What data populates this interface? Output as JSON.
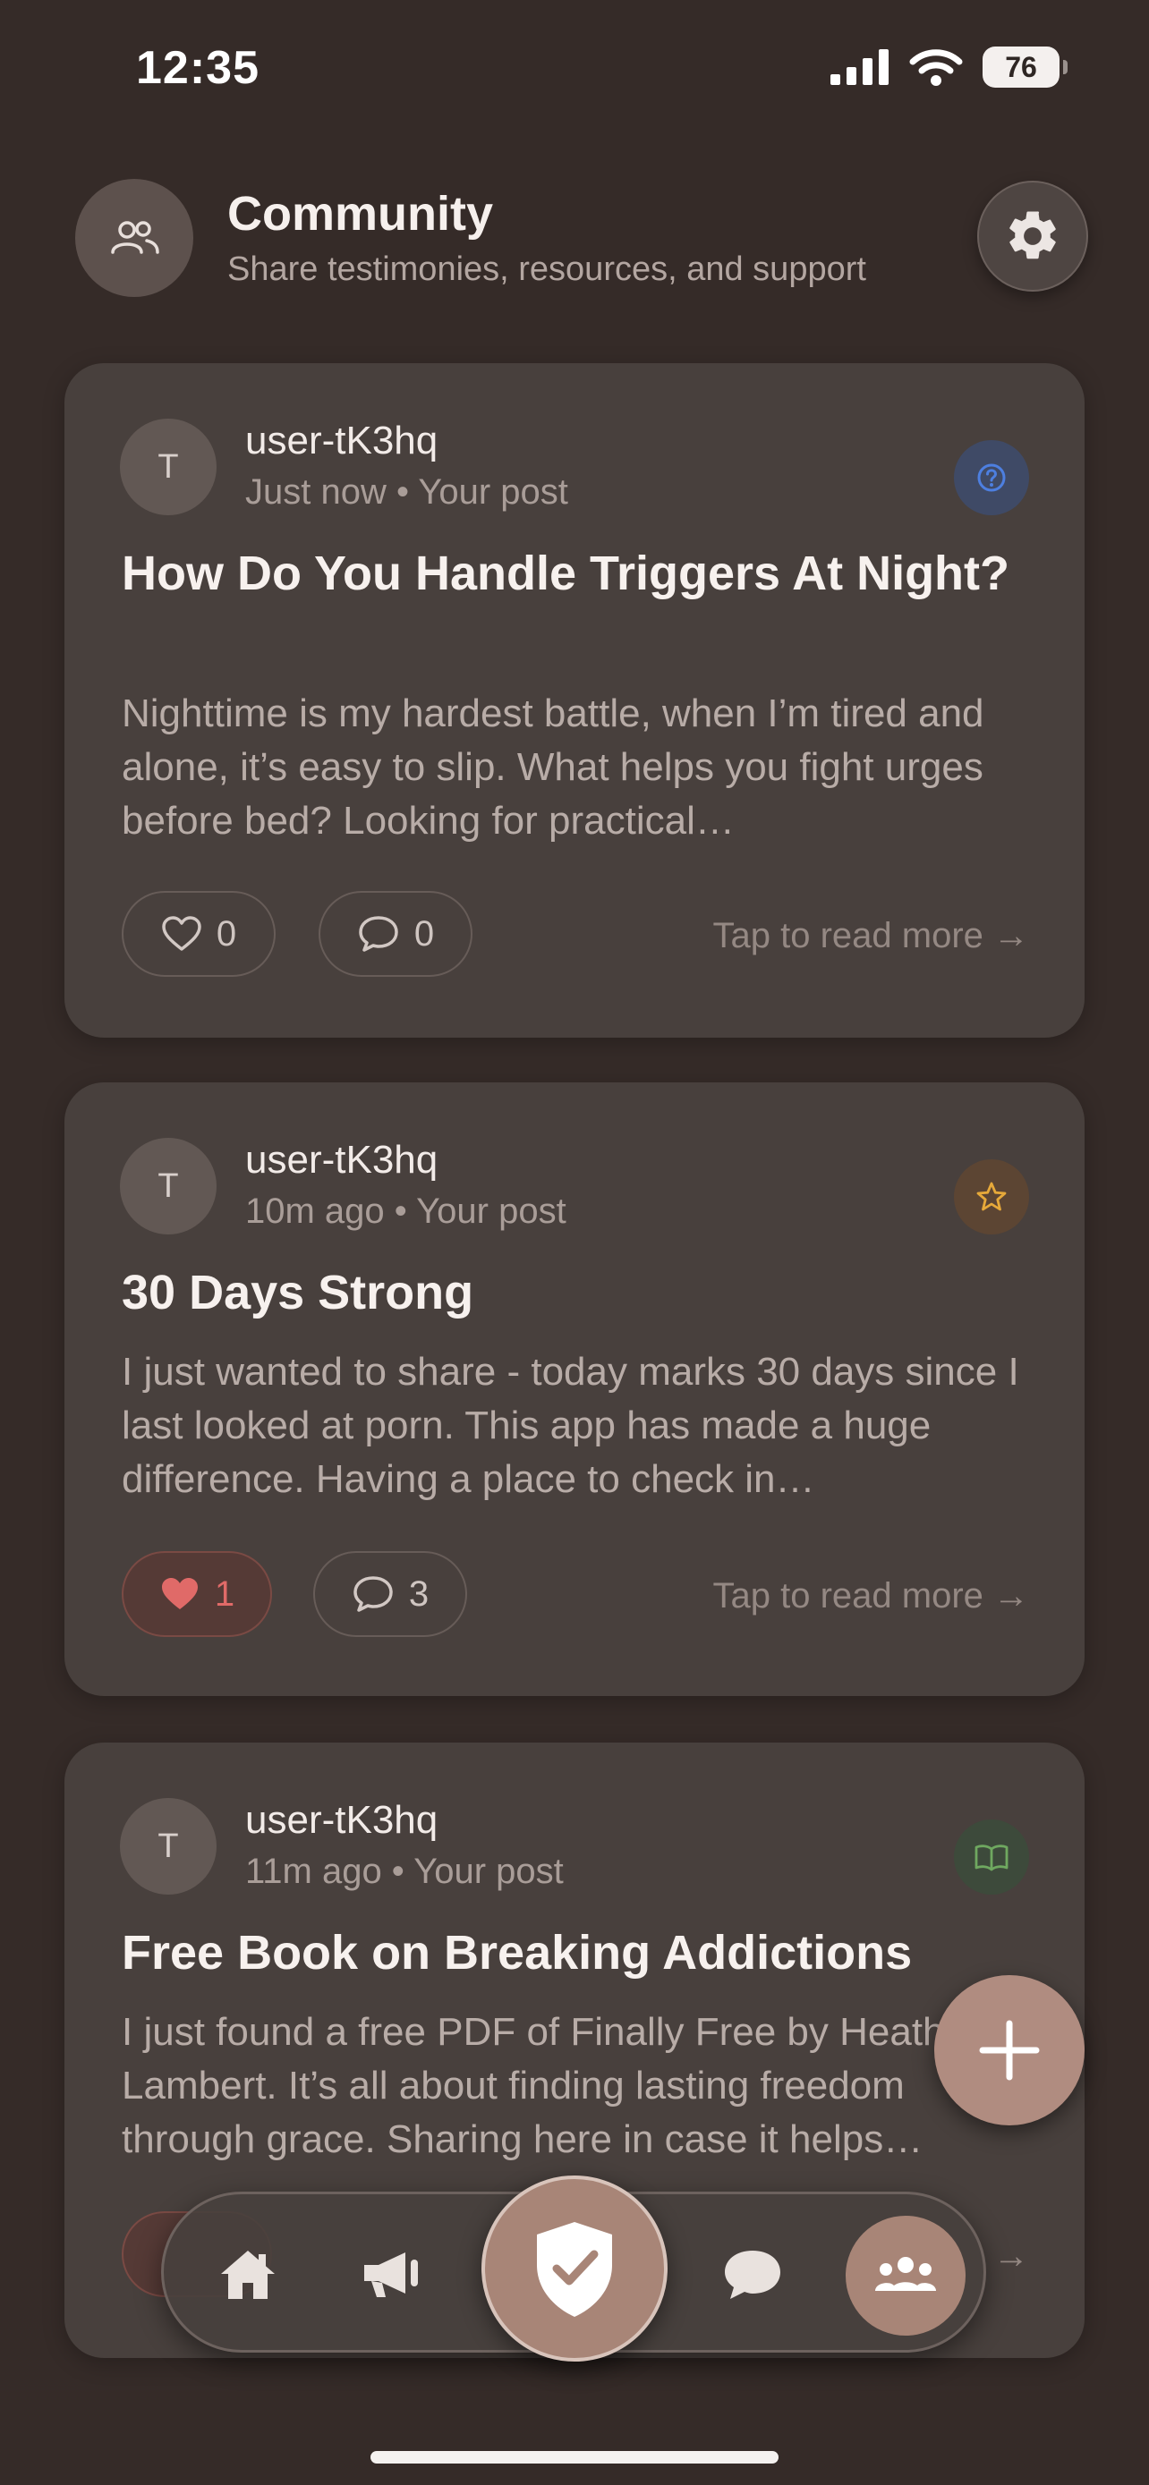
{
  "status_bar": {
    "time": "12:35",
    "battery": "76"
  },
  "header": {
    "title": "Community",
    "subtitle": "Share testimonies, resources, and support",
    "icon": "people-icon",
    "settings_icon": "gear-icon"
  },
  "posts": [
    {
      "avatar_initial": "T",
      "author": "user-tK3hq",
      "meta": "Just now • Your post",
      "type_icon": "question-icon",
      "title": "How Do You Handle Triggers At Night?",
      "excerpt": "Nighttime is my hardest battle, when I’m tired and alone, it’s easy to slip. What helps you fight urges before bed? Looking for practical…",
      "likes": "0",
      "liked": false,
      "comments": "0",
      "read_more": "Tap to read more →"
    },
    {
      "avatar_initial": "T",
      "author": "user-tK3hq",
      "meta": "10m ago • Your post",
      "type_icon": "star-icon",
      "title": "30 Days Strong",
      "excerpt": "I just wanted to share - today marks 30 days since I last looked at porn. This app has made a huge difference. Having a place to check in…",
      "likes": "1",
      "liked": true,
      "comments": "3",
      "read_more": "Tap to read more →"
    },
    {
      "avatar_initial": "T",
      "author": "user-tK3hq",
      "meta": "11m ago • Your post",
      "type_icon": "book-icon",
      "title": "Free Book on Breaking Addictions",
      "excerpt": "I just found a free PDF of Finally Free by Heath Lambert. It’s all about finding lasting freedom through grace. Sharing here in case it helps…",
      "read_more": "→"
    }
  ],
  "colors": {
    "background": "#352b28",
    "card": "#48403d",
    "accent": "#a88577",
    "liked": "#e06a68"
  },
  "tab_bar": {
    "items": [
      "home-icon",
      "megaphone-icon",
      "shield-check-icon",
      "chat-icon",
      "community-icon"
    ],
    "active": "community-icon"
  },
  "fab": {
    "icon": "plus-icon"
  }
}
